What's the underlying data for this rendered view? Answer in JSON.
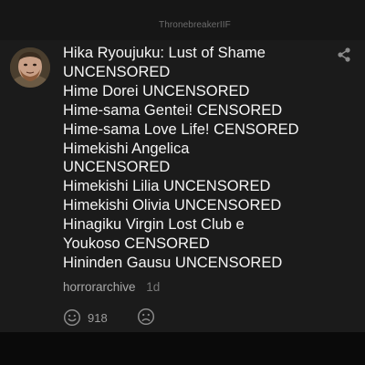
{
  "header": {
    "username": "ThronebreakerIIF"
  },
  "comment": {
    "lines": [
      "Hika Ryoujuku: Lust of Shame",
      "UNCENSORED",
      "Hime Dorei UNCENSORED",
      "Hime-sama Gentei! CENSORED",
      "Hime-sama Love Life! CENSORED",
      "Himekishi Angelica",
      "UNCENSORED",
      "Himekishi Lilia UNCENSORED",
      "Himekishi Olivia UNCENSORED",
      "Hinagiku Virgin Lost Club e",
      "Youkoso CENSORED",
      "Hininden Gausu UNCENSORED"
    ],
    "author": "horrorarchive",
    "time": "1d",
    "likes": "918"
  },
  "icons": {
    "share": "share-icon",
    "like": "smiley-icon",
    "dislike": "sad-face-icon"
  },
  "colors": {
    "background": "#0d0d0d",
    "card": "#1b1b1b",
    "text": "#f5f5f5",
    "meta": "#a9a9a9",
    "icon": "#8a8a8a"
  }
}
